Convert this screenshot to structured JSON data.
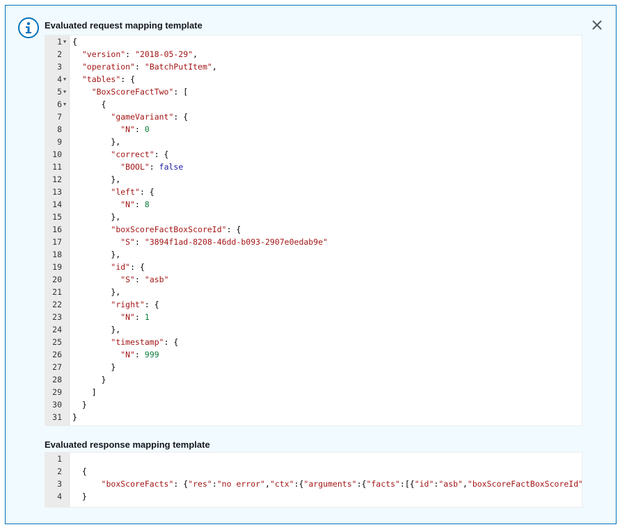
{
  "dialog": {
    "request_title": "Evaluated request mapping template",
    "response_title": "Evaluated response mapping template"
  },
  "icons": {
    "info": "info-icon",
    "close": "close-icon",
    "fold": "fold-arrow-icon"
  },
  "colors": {
    "panel_border": "#0073bb",
    "panel_background": "#f1faff",
    "json_key": "#a31515",
    "json_string": "#a31515",
    "json_number": "#0b7a3b",
    "json_boolean": "#1a1aa6"
  },
  "request_template": {
    "lines": [
      {
        "n": "1",
        "fold": true,
        "tokens": [
          {
            "t": "p",
            "v": "{"
          }
        ]
      },
      {
        "n": "2",
        "fold": false,
        "tokens": [
          {
            "t": "p",
            "v": "  "
          },
          {
            "t": "k",
            "v": "\"version\""
          },
          {
            "t": "p",
            "v": ": "
          },
          {
            "t": "s",
            "v": "\"2018-05-29\""
          },
          {
            "t": "p",
            "v": ","
          }
        ]
      },
      {
        "n": "3",
        "fold": false,
        "tokens": [
          {
            "t": "p",
            "v": "  "
          },
          {
            "t": "k",
            "v": "\"operation\""
          },
          {
            "t": "p",
            "v": ": "
          },
          {
            "t": "s",
            "v": "\"BatchPutItem\""
          },
          {
            "t": "p",
            "v": ","
          }
        ]
      },
      {
        "n": "4",
        "fold": true,
        "tokens": [
          {
            "t": "p",
            "v": "  "
          },
          {
            "t": "k",
            "v": "\"tables\""
          },
          {
            "t": "p",
            "v": ": {"
          }
        ]
      },
      {
        "n": "5",
        "fold": true,
        "tokens": [
          {
            "t": "p",
            "v": "    "
          },
          {
            "t": "k",
            "v": "\"BoxScoreFactTwo\""
          },
          {
            "t": "p",
            "v": ": ["
          }
        ]
      },
      {
        "n": "6",
        "fold": true,
        "tokens": [
          {
            "t": "p",
            "v": "      {"
          }
        ]
      },
      {
        "n": "7",
        "fold": false,
        "tokens": [
          {
            "t": "p",
            "v": "        "
          },
          {
            "t": "k",
            "v": "\"gameVariant\""
          },
          {
            "t": "p",
            "v": ": {"
          }
        ]
      },
      {
        "n": "8",
        "fold": false,
        "tokens": [
          {
            "t": "p",
            "v": "          "
          },
          {
            "t": "k",
            "v": "\"N\""
          },
          {
            "t": "p",
            "v": ": "
          },
          {
            "t": "n",
            "v": "0"
          }
        ]
      },
      {
        "n": "9",
        "fold": false,
        "tokens": [
          {
            "t": "p",
            "v": "        },"
          }
        ]
      },
      {
        "n": "10",
        "fold": false,
        "tokens": [
          {
            "t": "p",
            "v": "        "
          },
          {
            "t": "k",
            "v": "\"correct\""
          },
          {
            "t": "p",
            "v": ": {"
          }
        ]
      },
      {
        "n": "11",
        "fold": false,
        "tokens": [
          {
            "t": "p",
            "v": "          "
          },
          {
            "t": "k",
            "v": "\"BOOL\""
          },
          {
            "t": "p",
            "v": ": "
          },
          {
            "t": "b",
            "v": "false"
          }
        ]
      },
      {
        "n": "12",
        "fold": false,
        "tokens": [
          {
            "t": "p",
            "v": "        },"
          }
        ]
      },
      {
        "n": "13",
        "fold": false,
        "tokens": [
          {
            "t": "p",
            "v": "        "
          },
          {
            "t": "k",
            "v": "\"left\""
          },
          {
            "t": "p",
            "v": ": {"
          }
        ]
      },
      {
        "n": "14",
        "fold": false,
        "tokens": [
          {
            "t": "p",
            "v": "          "
          },
          {
            "t": "k",
            "v": "\"N\""
          },
          {
            "t": "p",
            "v": ": "
          },
          {
            "t": "n",
            "v": "8"
          }
        ]
      },
      {
        "n": "15",
        "fold": false,
        "tokens": [
          {
            "t": "p",
            "v": "        },"
          }
        ]
      },
      {
        "n": "16",
        "fold": false,
        "tokens": [
          {
            "t": "p",
            "v": "        "
          },
          {
            "t": "k",
            "v": "\"boxScoreFactBoxScoreId\""
          },
          {
            "t": "p",
            "v": ": {"
          }
        ]
      },
      {
        "n": "17",
        "fold": false,
        "tokens": [
          {
            "t": "p",
            "v": "          "
          },
          {
            "t": "k",
            "v": "\"S\""
          },
          {
            "t": "p",
            "v": ": "
          },
          {
            "t": "s",
            "v": "\"3894f1ad-8208-46dd-b093-2907e0edab9e\""
          }
        ]
      },
      {
        "n": "18",
        "fold": false,
        "tokens": [
          {
            "t": "p",
            "v": "        },"
          }
        ]
      },
      {
        "n": "19",
        "fold": false,
        "tokens": [
          {
            "t": "p",
            "v": "        "
          },
          {
            "t": "k",
            "v": "\"id\""
          },
          {
            "t": "p",
            "v": ": {"
          }
        ]
      },
      {
        "n": "20",
        "fold": false,
        "tokens": [
          {
            "t": "p",
            "v": "          "
          },
          {
            "t": "k",
            "v": "\"S\""
          },
          {
            "t": "p",
            "v": ": "
          },
          {
            "t": "s",
            "v": "\"asb\""
          }
        ]
      },
      {
        "n": "21",
        "fold": false,
        "tokens": [
          {
            "t": "p",
            "v": "        },"
          }
        ]
      },
      {
        "n": "22",
        "fold": false,
        "tokens": [
          {
            "t": "p",
            "v": "        "
          },
          {
            "t": "k",
            "v": "\"right\""
          },
          {
            "t": "p",
            "v": ": {"
          }
        ]
      },
      {
        "n": "23",
        "fold": false,
        "tokens": [
          {
            "t": "p",
            "v": "          "
          },
          {
            "t": "k",
            "v": "\"N\""
          },
          {
            "t": "p",
            "v": ": "
          },
          {
            "t": "n",
            "v": "1"
          }
        ]
      },
      {
        "n": "24",
        "fold": false,
        "tokens": [
          {
            "t": "p",
            "v": "        },"
          }
        ]
      },
      {
        "n": "25",
        "fold": false,
        "tokens": [
          {
            "t": "p",
            "v": "        "
          },
          {
            "t": "k",
            "v": "\"timestamp\""
          },
          {
            "t": "p",
            "v": ": {"
          }
        ]
      },
      {
        "n": "26",
        "fold": false,
        "tokens": [
          {
            "t": "p",
            "v": "          "
          },
          {
            "t": "k",
            "v": "\"N\""
          },
          {
            "t": "p",
            "v": ": "
          },
          {
            "t": "n",
            "v": "999"
          }
        ]
      },
      {
        "n": "27",
        "fold": false,
        "tokens": [
          {
            "t": "p",
            "v": "        }"
          }
        ]
      },
      {
        "n": "28",
        "fold": false,
        "tokens": [
          {
            "t": "p",
            "v": "      }"
          }
        ]
      },
      {
        "n": "29",
        "fold": false,
        "tokens": [
          {
            "t": "p",
            "v": "    ]"
          }
        ]
      },
      {
        "n": "30",
        "fold": false,
        "tokens": [
          {
            "t": "p",
            "v": "  }"
          }
        ]
      },
      {
        "n": "31",
        "fold": false,
        "tokens": [
          {
            "t": "p",
            "v": "}"
          }
        ]
      }
    ]
  },
  "response_template": {
    "lines": [
      {
        "n": "1",
        "fold": false,
        "tokens": [
          {
            "t": "p",
            "v": ""
          }
        ]
      },
      {
        "n": "2",
        "fold": false,
        "tokens": [
          {
            "t": "p",
            "v": "  {"
          }
        ]
      },
      {
        "n": "3",
        "fold": false,
        "tokens": [
          {
            "t": "p",
            "v": "      "
          },
          {
            "t": "k",
            "v": "\"boxScoreFacts\""
          },
          {
            "t": "p",
            "v": ": {"
          },
          {
            "t": "k",
            "v": "\"res\""
          },
          {
            "t": "p",
            "v": ":"
          },
          {
            "t": "s",
            "v": "\"no error\""
          },
          {
            "t": "p",
            "v": ","
          },
          {
            "t": "k",
            "v": "\"ctx\""
          },
          {
            "t": "p",
            "v": ":{"
          },
          {
            "t": "k",
            "v": "\"arguments\""
          },
          {
            "t": "p",
            "v": ":{"
          },
          {
            "t": "k",
            "v": "\"facts\""
          },
          {
            "t": "p",
            "v": ":[{"
          },
          {
            "t": "k",
            "v": "\"id\""
          },
          {
            "t": "p",
            "v": ":"
          },
          {
            "t": "s",
            "v": "\"asb\""
          },
          {
            "t": "p",
            "v": ","
          },
          {
            "t": "k",
            "v": "\"boxScoreFactBoxScoreId\""
          }
        ]
      },
      {
        "n": "4",
        "fold": false,
        "tokens": [
          {
            "t": "p",
            "v": "  }"
          }
        ]
      }
    ]
  }
}
